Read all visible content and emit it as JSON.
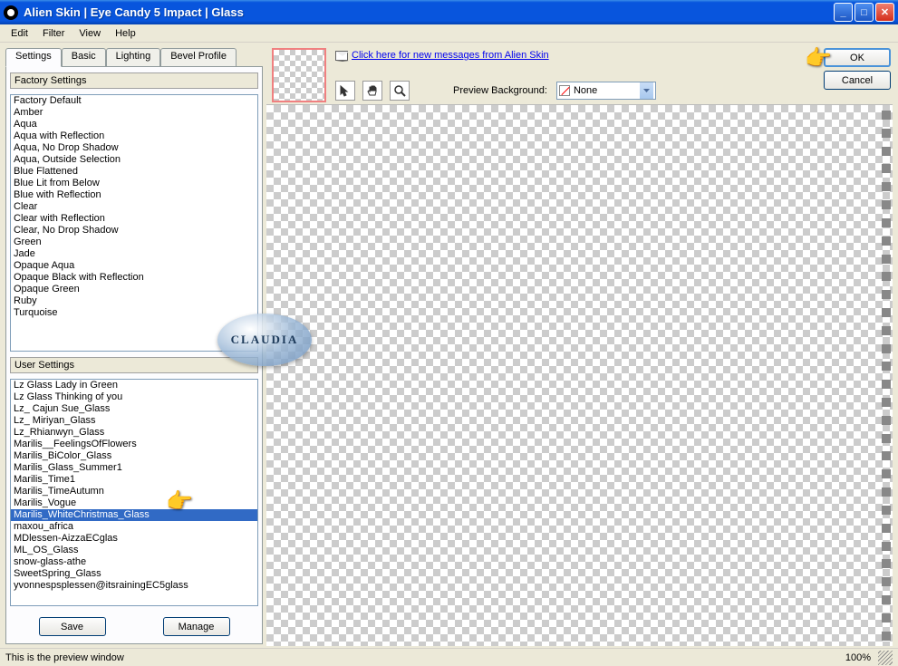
{
  "titlebar": {
    "text": "Alien Skin  |  Eye Candy 5 Impact  |  Glass"
  },
  "menus": [
    "Edit",
    "Filter",
    "View",
    "Help"
  ],
  "tabs": [
    "Settings",
    "Basic",
    "Lighting",
    "Bevel Profile"
  ],
  "factory_label": "Factory Settings",
  "factory_items": [
    "Factory Default",
    "Amber",
    "Aqua",
    "Aqua with Reflection",
    "Aqua, No Drop Shadow",
    "Aqua, Outside Selection",
    "Blue Flattened",
    "Blue Lit from Below",
    "Blue with Reflection",
    "Clear",
    "Clear with Reflection",
    "Clear, No Drop Shadow",
    "Green",
    "Jade",
    "Opaque Aqua",
    "Opaque Black with Reflection",
    "Opaque Green",
    "Ruby",
    "Turquoise"
  ],
  "user_label": "User Settings",
  "user_items": [
    "Lz Glass Lady in Green",
    "Lz Glass Thinking of you",
    "Lz_ Cajun Sue_Glass",
    "Lz_ Miriyan_Glass",
    "Lz_Rhianwyn_Glass",
    "Marilis__FeelingsOfFlowers",
    "Marilis_BiColor_Glass",
    "Marilis_Glass_Summer1",
    "Marilis_Time1",
    "Marilis_TimeAutumn",
    "Marilis_Vogue",
    "Marilis_WhiteChristmas_Glass",
    "maxou_africa",
    "MDlessen-AizzaECglas",
    "ML_OS_Glass",
    "snow-glass-athe",
    "SweetSpring_Glass",
    "yvonnespsplessen@itsrainingEC5glass"
  ],
  "user_selected_index": 11,
  "buttons": {
    "save": "Save",
    "manage": "Manage",
    "ok": "OK",
    "cancel": "Cancel"
  },
  "message_link": "Click here for new messages from Alien Skin",
  "preview_bg_label": "Preview Background:",
  "preview_bg_value": "None",
  "status": {
    "text": "This is the preview window",
    "zoom": "100%"
  },
  "watermark": "CLAUDIA"
}
